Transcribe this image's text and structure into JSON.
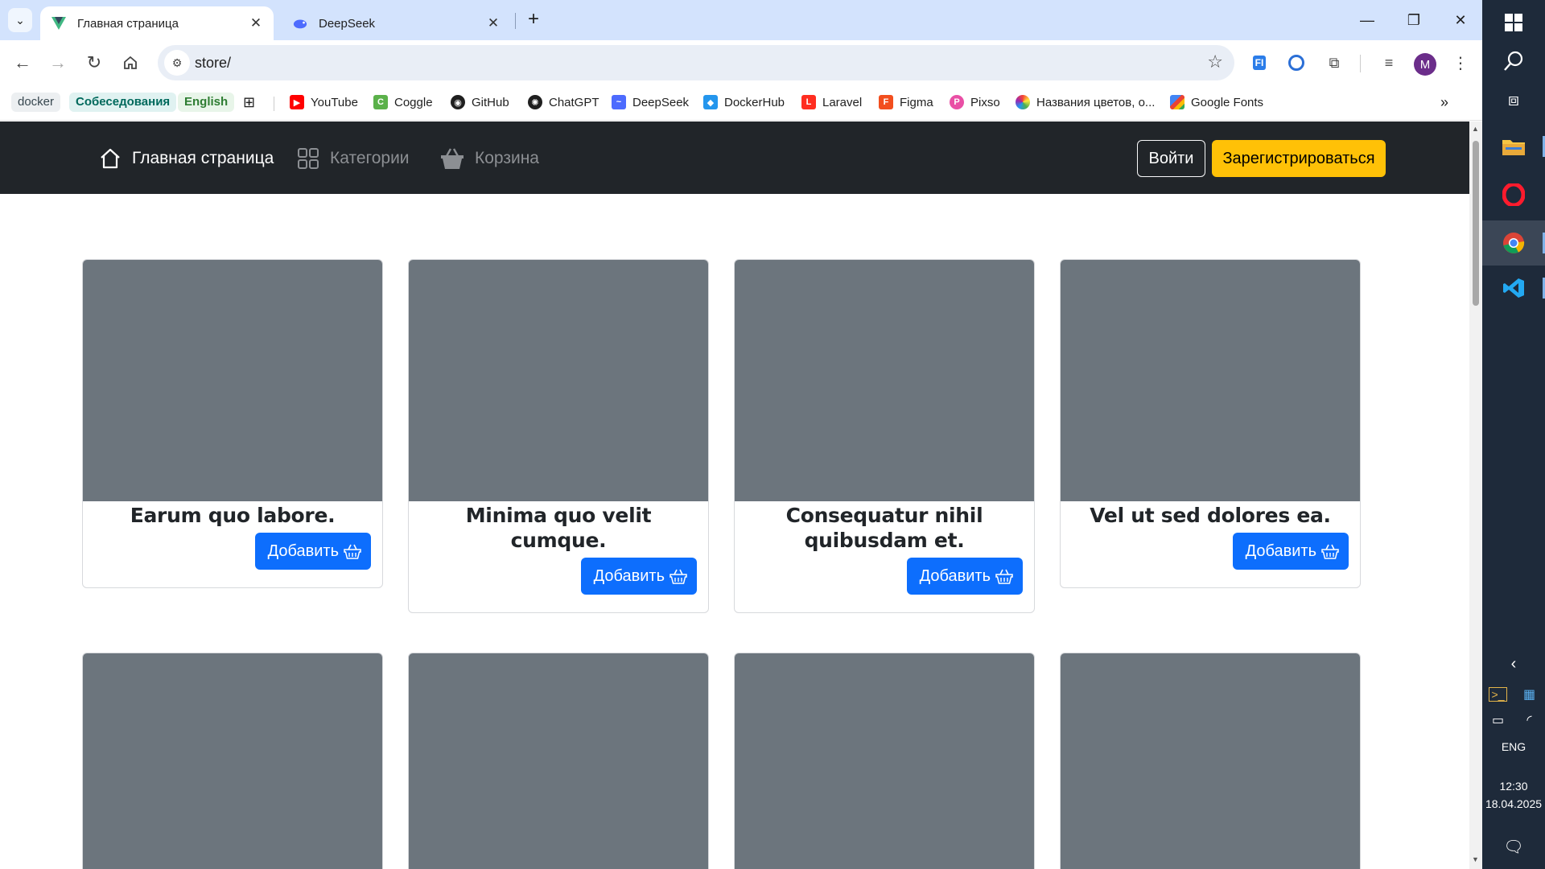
{
  "browser": {
    "tabs": [
      {
        "title": "Главная страница",
        "active": true,
        "favicon": "vue-icon"
      },
      {
        "title": "DeepSeek",
        "active": false,
        "favicon": "deepseek-icon"
      }
    ],
    "address": "store/",
    "profile_initial": "M",
    "bookmarks": {
      "chips": [
        "docker",
        "Собеседования",
        "English"
      ],
      "links": [
        "YouTube",
        "Coggle",
        "GitHub",
        "ChatGPT",
        "DeepSeek",
        "DockerHub",
        "Laravel",
        "Figma",
        "Pixso",
        "Названия цветов, о...",
        "Google Fonts"
      ]
    }
  },
  "navbar": {
    "home": "Главная страница",
    "categories": "Категории",
    "cart": "Корзина",
    "login": "Войти",
    "register": "Зарегистрироваться"
  },
  "products": [
    {
      "title": "Earum quo labore.",
      "button": "Добавить"
    },
    {
      "title": "Minima quo velit cumque.",
      "button": "Добавить"
    },
    {
      "title": "Consequatur nihil quibusdam et.",
      "button": "Добавить"
    },
    {
      "title": "Vel ut sed dolores ea.",
      "button": "Добавить"
    }
  ],
  "taskbar": {
    "language": "ENG",
    "time": "12:30",
    "date": "18.04.2025"
  },
  "colors": {
    "navbar_bg": "#212529",
    "placeholder_img": "#6c757d",
    "primary_button": "#0d6efd",
    "register_button": "#ffc107",
    "tabstrip": "#d3e3fd"
  }
}
